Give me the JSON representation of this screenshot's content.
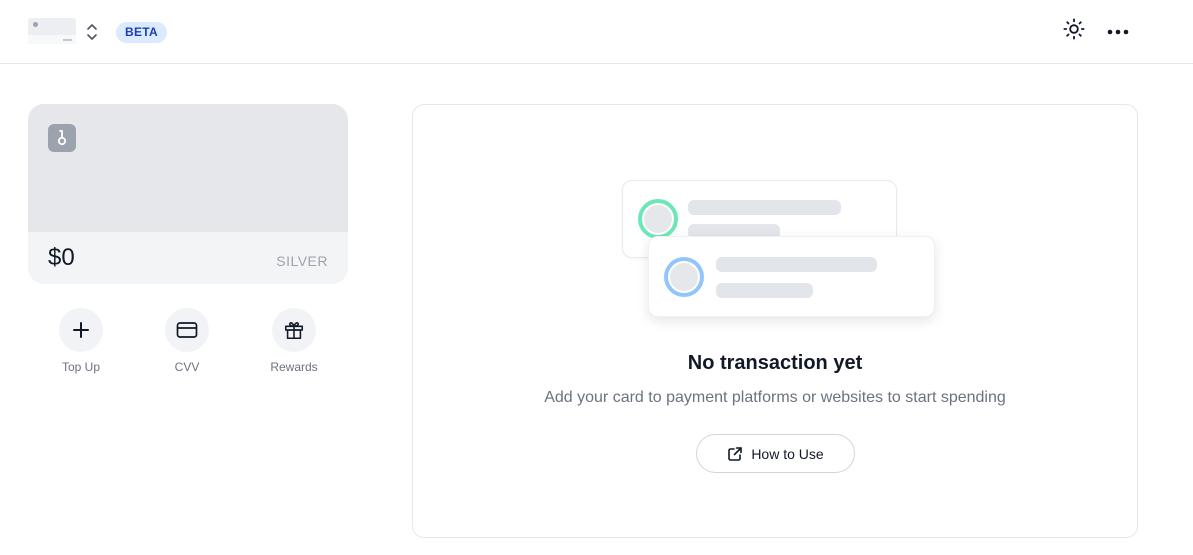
{
  "header": {
    "badge": "BETA",
    "icons": [
      "card-thumbnail",
      "chevron-up-down-icon",
      "sun-icon",
      "more-horizontal-icon"
    ]
  },
  "balance_card": {
    "amount": "$0",
    "tier": "SILVER",
    "logo_icon": "card-brand-icon"
  },
  "actions": [
    {
      "label": "Top Up",
      "icon": "plus-icon"
    },
    {
      "label": "CVV",
      "icon": "credit-card-icon"
    },
    {
      "label": "Rewards",
      "icon": "gift-icon"
    }
  ],
  "empty_state": {
    "title": "No transaction yet",
    "subtitle": "Add your card to payment platforms or websites to start spending",
    "button_label": "How to Use",
    "button_icon": "external-link-icon"
  },
  "colors": {
    "badge_bg": "#dbeafe",
    "badge_text": "#1e40af",
    "ring_green": "#6ee7b7",
    "ring_blue": "#93c5fd"
  }
}
